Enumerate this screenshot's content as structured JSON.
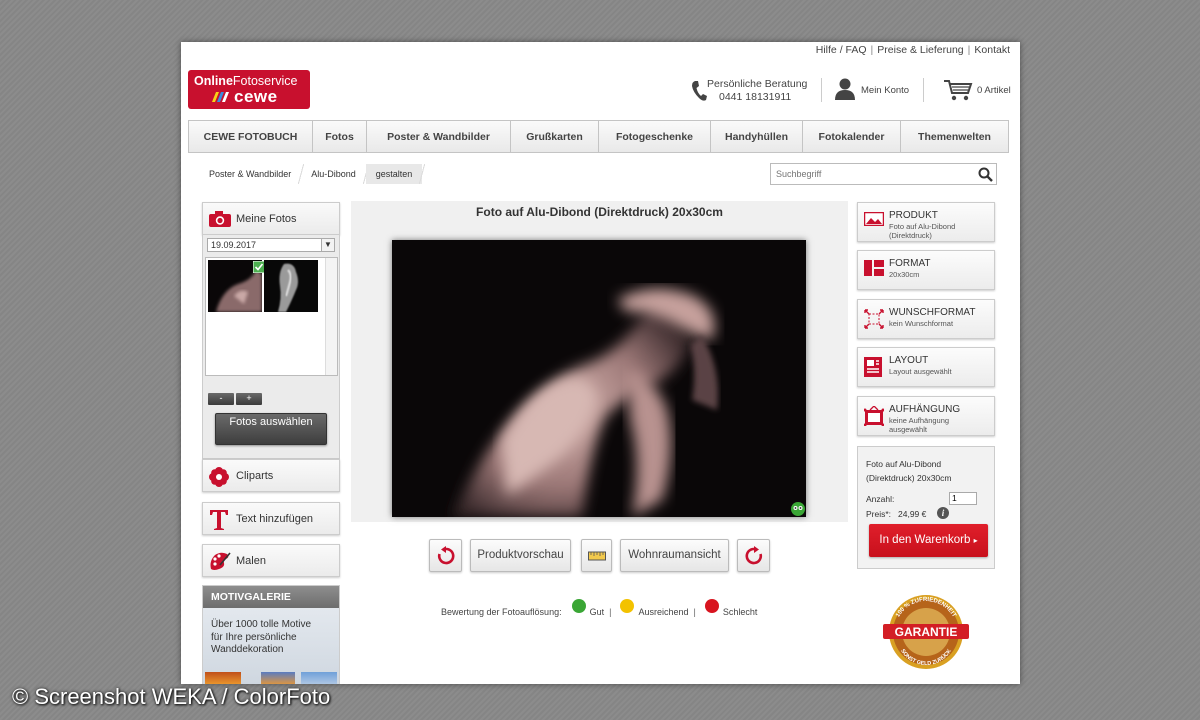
{
  "toplinks": {
    "help": "Hilfe / FAQ",
    "prices": "Preise & Lieferung",
    "contact": "Kontakt",
    "sep": "|"
  },
  "logo": {
    "line1a": "Online",
    "line1b": "Fotoservice",
    "line2": "cewe"
  },
  "header": {
    "phone_label": "Persönliche Beratung",
    "phone_number": "0441 18131911",
    "account": "Mein Konto",
    "cart": "0 Artikel"
  },
  "nav": [
    "CEWE FOTOBUCH",
    "Fotos",
    "Poster & Wandbilder",
    "Grußkarten",
    "Fotogeschenke",
    "Handyhüllen",
    "Fotokalender",
    "Themenwelten"
  ],
  "breadcrumb": [
    "Poster & Wandbilder",
    "Alu-Dibond",
    "gestalten"
  ],
  "search": {
    "placeholder": "Suchbegriff"
  },
  "sidebar": {
    "my_photos": "Meine Fotos",
    "date": "19.09.2017",
    "zoom_out": "-",
    "zoom_in": "+",
    "select_photos": "Fotos auswählen",
    "cliparts": "Cliparts",
    "add_text": "Text hinzufügen",
    "paint": "Malen",
    "gallery_title": "MOTIVGALERIE",
    "gallery_text": [
      "Über 1000 tolle Motive",
      "für Ihre persönliche",
      "Wanddekoration"
    ]
  },
  "editor": {
    "title": "Foto auf Alu-Dibond (Direktdruck) 20x30cm",
    "preview": "Produktvorschau",
    "room_view": "Wohnraumansicht",
    "rating_label": "Bewertung der Fotoauflösung:",
    "rating_good": "Gut",
    "rating_ok": "Ausreichend",
    "rating_bad": "Schlecht",
    "sep": "|"
  },
  "options": [
    {
      "title": "PRODUKT",
      "sub": "Foto auf Alu-Dibond (Direktdruck)"
    },
    {
      "title": "FORMAT",
      "sub": "20x30cm"
    },
    {
      "title": "WUNSCHFORMAT",
      "sub": "kein Wunschformat"
    },
    {
      "title": "LAYOUT",
      "sub": "Layout ausgewählt"
    },
    {
      "title": "AUFHÄNGUNG",
      "sub": "keine Aufhängung ausgewählt"
    }
  ],
  "order": {
    "name": "Foto auf Alu-Dibond (Direktdruck) 20x30cm",
    "qty_label": "Anzahl:",
    "qty": "1",
    "price_label": "Preis*:",
    "price": "24,99 €",
    "info": "i",
    "add_to_cart": "In den Warenkorb"
  },
  "seal": {
    "top": "100 % ZUFRIEDENHEIT",
    "main": "GARANTIE",
    "bottom": "SONST GELD ZURÜCK"
  },
  "watermark": "© Screenshot WEKA / ColorFoto",
  "colors": {
    "brand_red": "#c8102e",
    "good": "#3aa635",
    "ok": "#f3c200",
    "bad": "#d8141f"
  }
}
